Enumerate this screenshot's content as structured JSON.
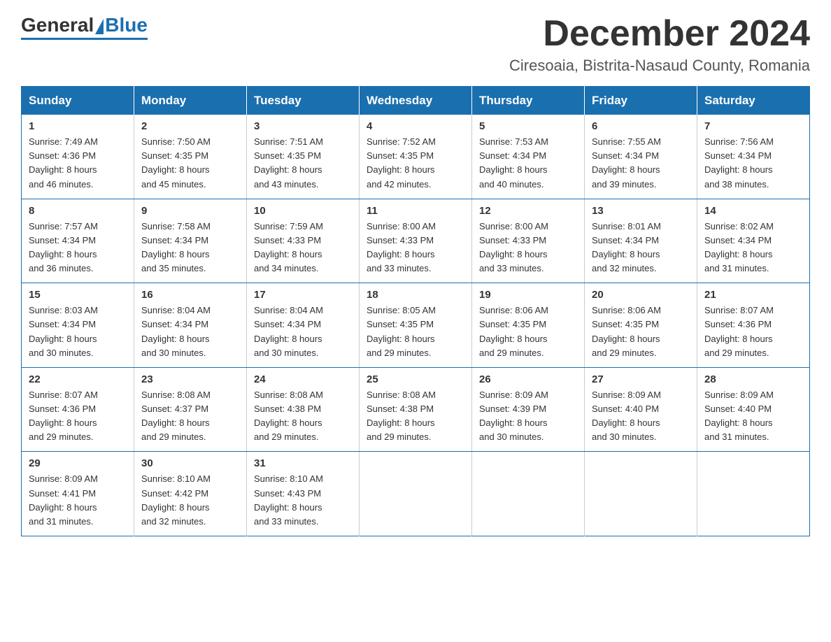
{
  "header": {
    "logo_general": "General",
    "logo_blue": "Blue",
    "month": "December 2024",
    "location": "Ciresoaia, Bistrita-Nasaud County, Romania"
  },
  "days_of_week": [
    "Sunday",
    "Monday",
    "Tuesday",
    "Wednesday",
    "Thursday",
    "Friday",
    "Saturday"
  ],
  "weeks": [
    [
      {
        "day": "1",
        "sunrise": "7:49 AM",
        "sunset": "4:36 PM",
        "daylight": "8 hours and 46 minutes."
      },
      {
        "day": "2",
        "sunrise": "7:50 AM",
        "sunset": "4:35 PM",
        "daylight": "8 hours and 45 minutes."
      },
      {
        "day": "3",
        "sunrise": "7:51 AM",
        "sunset": "4:35 PM",
        "daylight": "8 hours and 43 minutes."
      },
      {
        "day": "4",
        "sunrise": "7:52 AM",
        "sunset": "4:35 PM",
        "daylight": "8 hours and 42 minutes."
      },
      {
        "day": "5",
        "sunrise": "7:53 AM",
        "sunset": "4:34 PM",
        "daylight": "8 hours and 40 minutes."
      },
      {
        "day": "6",
        "sunrise": "7:55 AM",
        "sunset": "4:34 PM",
        "daylight": "8 hours and 39 minutes."
      },
      {
        "day": "7",
        "sunrise": "7:56 AM",
        "sunset": "4:34 PM",
        "daylight": "8 hours and 38 minutes."
      }
    ],
    [
      {
        "day": "8",
        "sunrise": "7:57 AM",
        "sunset": "4:34 PM",
        "daylight": "8 hours and 36 minutes."
      },
      {
        "day": "9",
        "sunrise": "7:58 AM",
        "sunset": "4:34 PM",
        "daylight": "8 hours and 35 minutes."
      },
      {
        "day": "10",
        "sunrise": "7:59 AM",
        "sunset": "4:33 PM",
        "daylight": "8 hours and 34 minutes."
      },
      {
        "day": "11",
        "sunrise": "8:00 AM",
        "sunset": "4:33 PM",
        "daylight": "8 hours and 33 minutes."
      },
      {
        "day": "12",
        "sunrise": "8:00 AM",
        "sunset": "4:33 PM",
        "daylight": "8 hours and 33 minutes."
      },
      {
        "day": "13",
        "sunrise": "8:01 AM",
        "sunset": "4:34 PM",
        "daylight": "8 hours and 32 minutes."
      },
      {
        "day": "14",
        "sunrise": "8:02 AM",
        "sunset": "4:34 PM",
        "daylight": "8 hours and 31 minutes."
      }
    ],
    [
      {
        "day": "15",
        "sunrise": "8:03 AM",
        "sunset": "4:34 PM",
        "daylight": "8 hours and 30 minutes."
      },
      {
        "day": "16",
        "sunrise": "8:04 AM",
        "sunset": "4:34 PM",
        "daylight": "8 hours and 30 minutes."
      },
      {
        "day": "17",
        "sunrise": "8:04 AM",
        "sunset": "4:34 PM",
        "daylight": "8 hours and 30 minutes."
      },
      {
        "day": "18",
        "sunrise": "8:05 AM",
        "sunset": "4:35 PM",
        "daylight": "8 hours and 29 minutes."
      },
      {
        "day": "19",
        "sunrise": "8:06 AM",
        "sunset": "4:35 PM",
        "daylight": "8 hours and 29 minutes."
      },
      {
        "day": "20",
        "sunrise": "8:06 AM",
        "sunset": "4:35 PM",
        "daylight": "8 hours and 29 minutes."
      },
      {
        "day": "21",
        "sunrise": "8:07 AM",
        "sunset": "4:36 PM",
        "daylight": "8 hours and 29 minutes."
      }
    ],
    [
      {
        "day": "22",
        "sunrise": "8:07 AM",
        "sunset": "4:36 PM",
        "daylight": "8 hours and 29 minutes."
      },
      {
        "day": "23",
        "sunrise": "8:08 AM",
        "sunset": "4:37 PM",
        "daylight": "8 hours and 29 minutes."
      },
      {
        "day": "24",
        "sunrise": "8:08 AM",
        "sunset": "4:38 PM",
        "daylight": "8 hours and 29 minutes."
      },
      {
        "day": "25",
        "sunrise": "8:08 AM",
        "sunset": "4:38 PM",
        "daylight": "8 hours and 29 minutes."
      },
      {
        "day": "26",
        "sunrise": "8:09 AM",
        "sunset": "4:39 PM",
        "daylight": "8 hours and 30 minutes."
      },
      {
        "day": "27",
        "sunrise": "8:09 AM",
        "sunset": "4:40 PM",
        "daylight": "8 hours and 30 minutes."
      },
      {
        "day": "28",
        "sunrise": "8:09 AM",
        "sunset": "4:40 PM",
        "daylight": "8 hours and 31 minutes."
      }
    ],
    [
      {
        "day": "29",
        "sunrise": "8:09 AM",
        "sunset": "4:41 PM",
        "daylight": "8 hours and 31 minutes."
      },
      {
        "day": "30",
        "sunrise": "8:10 AM",
        "sunset": "4:42 PM",
        "daylight": "8 hours and 32 minutes."
      },
      {
        "day": "31",
        "sunrise": "8:10 AM",
        "sunset": "4:43 PM",
        "daylight": "8 hours and 33 minutes."
      },
      null,
      null,
      null,
      null
    ]
  ],
  "labels": {
    "sunrise": "Sunrise:",
    "sunset": "Sunset:",
    "daylight": "Daylight:"
  }
}
